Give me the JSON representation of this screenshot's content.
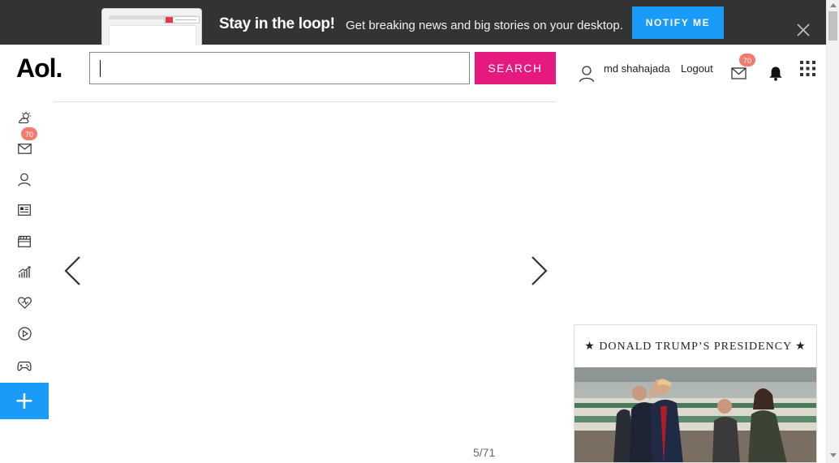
{
  "banner": {
    "title": "Stay in the loop!",
    "subtitle": "Get breaking news and big stories on your desktop.",
    "notify_label": "NOTIFY ME",
    "close_icon": "close-icon"
  },
  "header": {
    "logo": "Aol.",
    "search_value": "",
    "search_label": "SEARCH",
    "user_name": "md shahajada",
    "logout_label": "Logout",
    "mail_count": "70"
  },
  "sidebar": {
    "items": [
      {
        "icon": "weather-icon"
      },
      {
        "icon": "mail-icon",
        "badge": "70"
      },
      {
        "icon": "user-icon"
      },
      {
        "icon": "news-icon"
      },
      {
        "icon": "clapperboard-icon"
      },
      {
        "icon": "finance-chart-icon"
      },
      {
        "icon": "heart-icon"
      },
      {
        "icon": "play-icon"
      },
      {
        "icon": "gamepad-icon"
      }
    ],
    "add_label": "+"
  },
  "slideshow": {
    "counter": "5/71"
  },
  "card": {
    "title": "★ DONALD TRUMP’S PRESIDENCY ★"
  },
  "colors": {
    "banner_bg": "#333333",
    "notify_blue": "#1a9bf7",
    "search_pink": "#e5197e",
    "badge": "#f4796e"
  }
}
